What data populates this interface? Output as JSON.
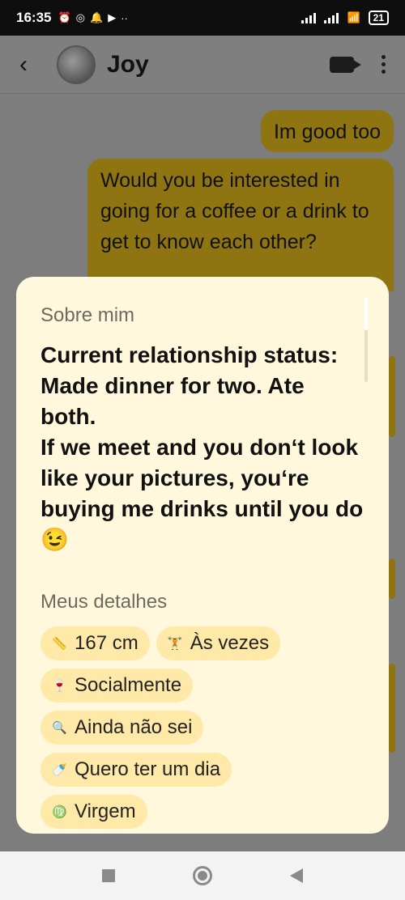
{
  "status_bar": {
    "time": "16:35",
    "battery": "21"
  },
  "chat": {
    "contact_name": "Joy",
    "messages": [
      {
        "text": "Im good too"
      },
      {
        "text": "Would you be interested in going for a coffee or a drink to get to know each other?"
      }
    ]
  },
  "profile": {
    "about_label": "Sobre mim",
    "bio": "Current relationship status: Made dinner for two. Ate both.\nIf we meet and you don‘t look like your pictures, you‘re buying me drinks until you do 😉",
    "details_label": "Meus detalhes",
    "details": [
      {
        "icon": "ruler-icon",
        "glyph": "📏",
        "label": "167 cm"
      },
      {
        "icon": "dumbbell-icon",
        "glyph": "🏋",
        "label": "Às vezes"
      },
      {
        "icon": "wine-glass-icon",
        "glyph": "🍷",
        "label": "Socialmente"
      },
      {
        "icon": "magnifier-icon",
        "glyph": "🔍",
        "label": "Ainda não sei"
      },
      {
        "icon": "baby-bottle-icon",
        "glyph": "🍼",
        "label": "Quero ter um dia"
      },
      {
        "icon": "zodiac-icon",
        "glyph": "♍",
        "label": "Virgem"
      }
    ]
  },
  "colors": {
    "accent": "#f7c41e",
    "sheet_bg": "#fff8dc",
    "chip_bg": "#ffe9a8"
  }
}
